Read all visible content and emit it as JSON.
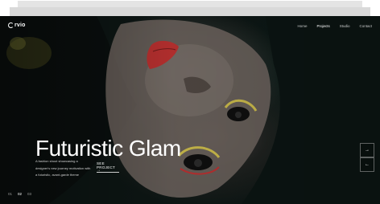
{
  "brand": {
    "logo_text": "rvio"
  },
  "nav": {
    "items": [
      {
        "label": "Home"
      },
      {
        "label": "Projects"
      },
      {
        "label": "Studio"
      },
      {
        "label": "Contact"
      }
    ],
    "active_index": 1
  },
  "hero": {
    "title": "Futuristic Glam",
    "description": "A fashion shoot showcasing a designer's new journey motivation with a futuristic, avant-garde theme",
    "cta_label": "SEE PROJECT",
    "cta_arrow": "→"
  },
  "slider_controls": {
    "next_icon": "arrow-right-icon",
    "prev_icon": "arrow-left-icon",
    "next_glyph": "→",
    "prev_glyph": "←"
  },
  "pager": {
    "items": [
      {
        "label": "01"
      },
      {
        "label": "02"
      },
      {
        "label": "03"
      }
    ],
    "active_index": 1
  },
  "colors": {
    "background": "#0d1614",
    "text": "#ffffff",
    "lip_accent": "#b7302f",
    "eye_accent": "#c8b84a"
  }
}
